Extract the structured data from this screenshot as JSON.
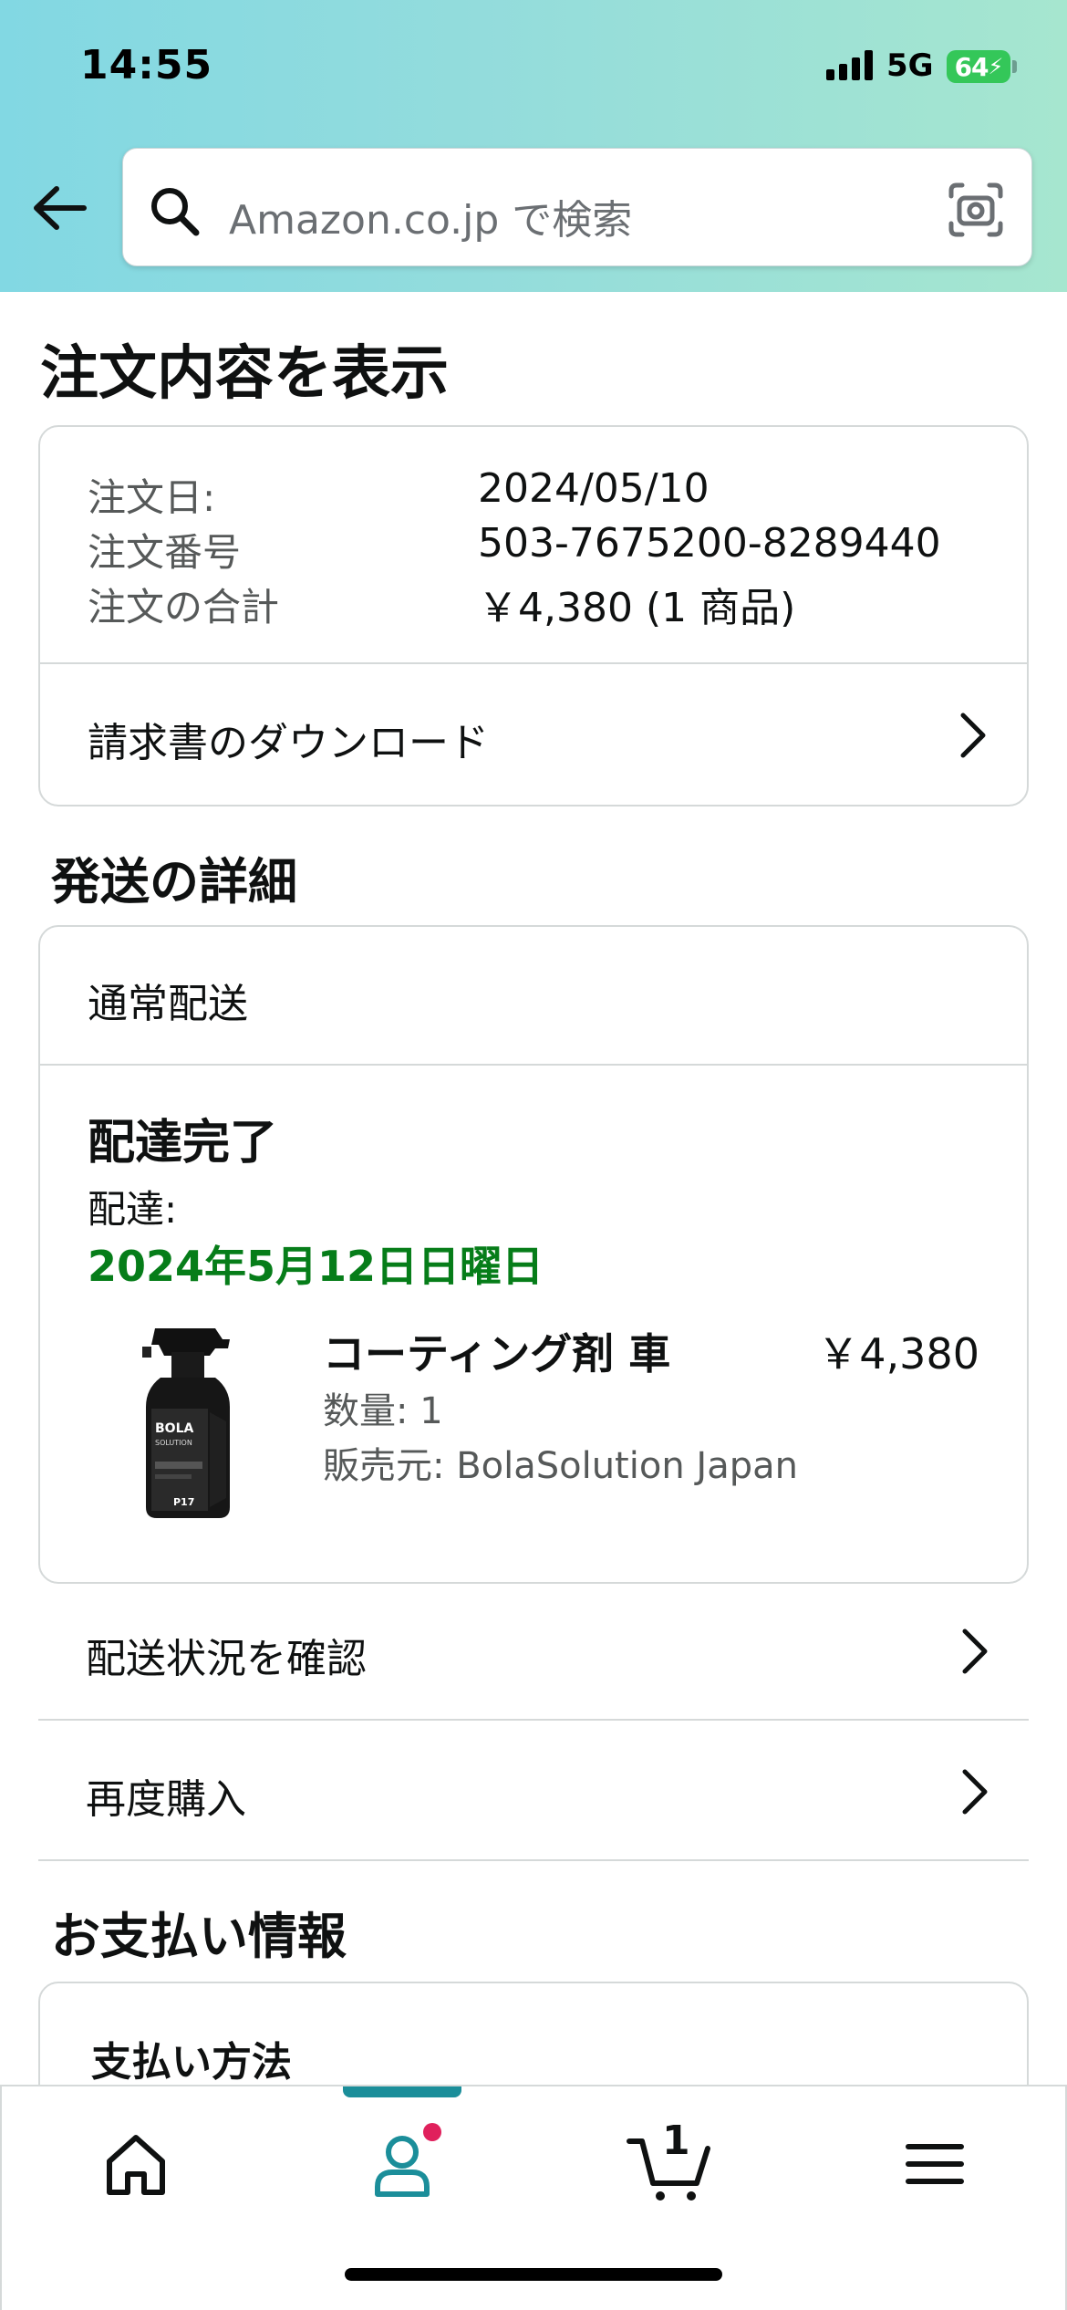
{
  "status_bar": {
    "time": "14:55",
    "network": "5G",
    "battery": "64"
  },
  "search": {
    "placeholder": "Amazon.co.jp で検索"
  },
  "page_title": "注文内容を表示",
  "order_summary": {
    "rows": [
      {
        "label": "注文日:",
        "value": "2024/05/10"
      },
      {
        "label": "注文番号",
        "value": "503-7675200-8289440"
      },
      {
        "label": "注文の合計",
        "value": "￥4,380 (1 商品)"
      }
    ],
    "invoice_link": "請求書のダウンロード"
  },
  "shipping": {
    "section_title": "発送の詳細",
    "method": "通常配送",
    "status": "配達完了",
    "delivered_label": "配達:",
    "delivered_date": "2024年5月12日日曜日",
    "item": {
      "title": "コーティング剤 車",
      "price": "￥4,380",
      "quantity": "数量: 1",
      "seller": "販売元: BolaSolution Japan",
      "image_brand": "BOLA",
      "image_sub": "SOLUTION",
      "image_code": "P17"
    },
    "track_link": "配送状況を確認",
    "buy_again_link": "再度購入"
  },
  "payment": {
    "section_title": "お支払い情報",
    "method_title": "支払い方法"
  },
  "nav": {
    "cart_count": "1"
  },
  "colors": {
    "accent_teal": "#1b8e9a",
    "delivery_green": "#067d19",
    "badge_pink": "#e0205c"
  }
}
